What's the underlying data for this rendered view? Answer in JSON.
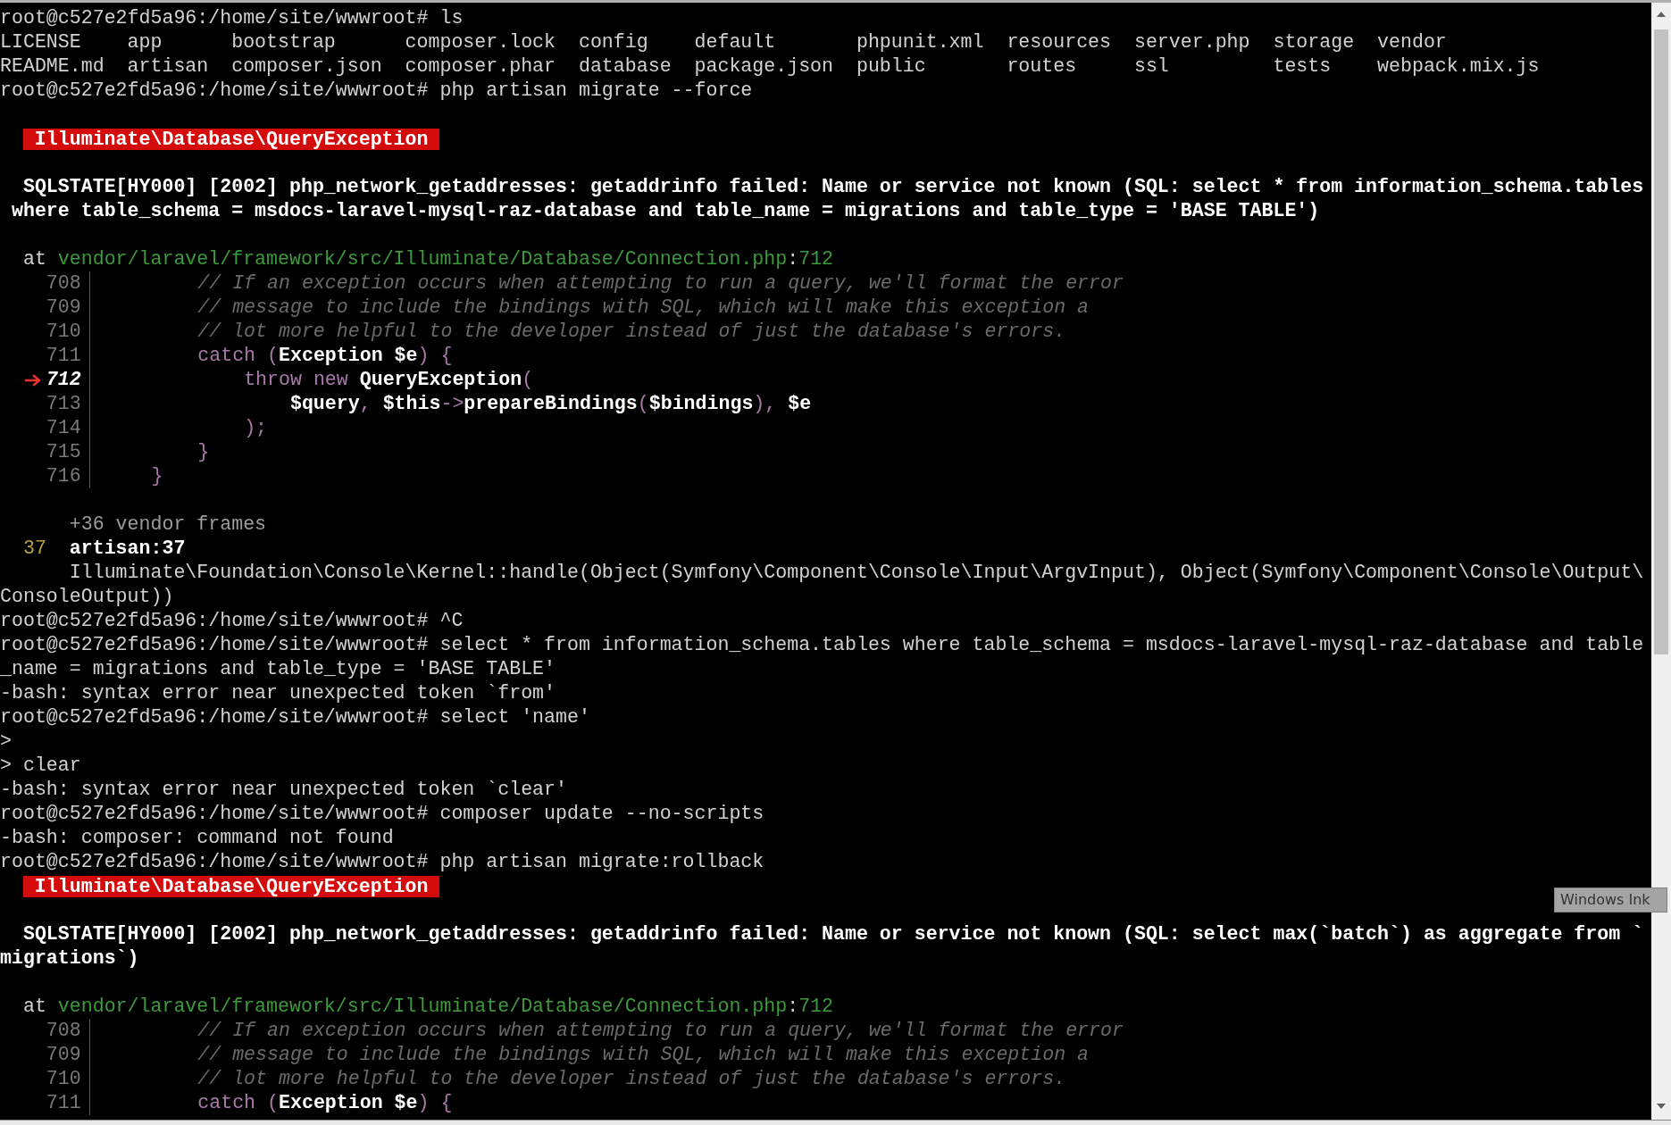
{
  "terminal": {
    "lines": [
      {
        "kind": "text",
        "segs": [
          {
            "kind": "plain",
            "text": "root@c527e2fd5a96:/home/site/wwwroot# ls"
          }
        ]
      },
      {
        "kind": "text",
        "segs": [
          {
            "kind": "plain",
            "text": "LICENSE    app      bootstrap      composer.lock  config    default       phpunit.xml  resources  server.php  storage  vendor"
          }
        ]
      },
      {
        "kind": "text",
        "segs": [
          {
            "kind": "plain",
            "text": "README.md  artisan  composer.json  composer.phar  database  package.json  public       routes     ssl         tests    webpack.mix.js"
          }
        ]
      },
      {
        "kind": "text",
        "segs": [
          {
            "kind": "plain",
            "text": "root@c527e2fd5a96:/home/site/wwwroot# php artisan migrate --force"
          }
        ]
      },
      {
        "kind": "blank"
      },
      {
        "kind": "badge",
        "text": "Illuminate\\Database\\QueryException"
      },
      {
        "kind": "blank"
      },
      {
        "kind": "text",
        "segs": [
          {
            "kind": "bold",
            "text": "  SQLSTATE[HY000] [2002] php_network_getaddresses: getaddrinfo failed: Name or service not known (SQL: select * from information_schema.tables"
          }
        ]
      },
      {
        "kind": "text",
        "segs": [
          {
            "kind": "bold",
            "text": " where table_schema = msdocs-laravel-mysql-raz-database and table_name = migrations and table_type = 'BASE TABLE')"
          }
        ]
      },
      {
        "kind": "blank"
      },
      {
        "kind": "text",
        "segs": [
          {
            "kind": "plain",
            "text": "  at "
          },
          {
            "kind": "path",
            "text": "vendor/laravel/framework/src/Illuminate/Database/Connection.php"
          },
          {
            "kind": "plain",
            "text": ":"
          },
          {
            "kind": "path",
            "text": "712"
          }
        ]
      },
      {
        "kind": "code",
        "number": "708",
        "current": false,
        "segs": [
          {
            "kind": "comment",
            "text": "        // If an exception occurs when attempting to run a query, we'll format the error"
          }
        ]
      },
      {
        "kind": "code",
        "number": "709",
        "current": false,
        "segs": [
          {
            "kind": "comment",
            "text": "        // message to include the bindings with SQL, which will make this exception a"
          }
        ]
      },
      {
        "kind": "code",
        "number": "710",
        "current": false,
        "segs": [
          {
            "kind": "comment",
            "text": "        // lot more helpful to the developer instead of just the database's errors."
          }
        ]
      },
      {
        "kind": "code",
        "number": "711",
        "current": false,
        "segs": [
          {
            "kind": "keyword",
            "text": "        catch"
          },
          {
            "kind": "keyword",
            "text": " ("
          },
          {
            "kind": "bold",
            "text": "Exception $e"
          },
          {
            "kind": "keyword",
            "text": ") {"
          }
        ]
      },
      {
        "kind": "code",
        "number": "712",
        "current": true,
        "segs": [
          {
            "kind": "keyword",
            "text": "            throw new "
          },
          {
            "kind": "bold",
            "text": "QueryException"
          },
          {
            "kind": "keyword",
            "text": "("
          }
        ]
      },
      {
        "kind": "code",
        "number": "713",
        "current": false,
        "segs": [
          {
            "kind": "bold",
            "text": "                $query"
          },
          {
            "kind": "keyword",
            "text": ", "
          },
          {
            "kind": "bold",
            "text": "$this"
          },
          {
            "kind": "keyword",
            "text": "->"
          },
          {
            "kind": "bold",
            "text": "prepareBindings"
          },
          {
            "kind": "keyword",
            "text": "("
          },
          {
            "kind": "bold",
            "text": "$bindings"
          },
          {
            "kind": "keyword",
            "text": "), "
          },
          {
            "kind": "bold",
            "text": "$e"
          }
        ]
      },
      {
        "kind": "code",
        "number": "714",
        "current": false,
        "segs": [
          {
            "kind": "keyword",
            "text": "            );"
          }
        ]
      },
      {
        "kind": "code",
        "number": "715",
        "current": false,
        "segs": [
          {
            "kind": "keyword",
            "text": "        }"
          }
        ]
      },
      {
        "kind": "code",
        "number": "716",
        "current": false,
        "segs": [
          {
            "kind": "keyword",
            "text": "    }"
          }
        ]
      },
      {
        "kind": "blank"
      },
      {
        "kind": "text",
        "segs": [
          {
            "kind": "dim",
            "text": "      +36 vendor frames"
          }
        ]
      },
      {
        "kind": "text",
        "segs": [
          {
            "kind": "yellow",
            "text": "  37"
          },
          {
            "kind": "bold",
            "text": "  artisan:37"
          }
        ]
      },
      {
        "kind": "text",
        "segs": [
          {
            "kind": "plain",
            "text": "      Illuminate\\Foundation\\Console\\Kernel::handle(Object(Symfony\\Component\\Console\\Input\\ArgvInput), Object(Symfony\\Component\\Console\\Output\\"
          }
        ]
      },
      {
        "kind": "text",
        "segs": [
          {
            "kind": "plain",
            "text": "ConsoleOutput))"
          }
        ]
      },
      {
        "kind": "text",
        "segs": [
          {
            "kind": "plain",
            "text": "root@c527e2fd5a96:/home/site/wwwroot# ^C"
          }
        ]
      },
      {
        "kind": "text",
        "segs": [
          {
            "kind": "plain",
            "text": "root@c527e2fd5a96:/home/site/wwwroot# select * from information_schema.tables where table_schema = msdocs-laravel-mysql-raz-database and table"
          }
        ]
      },
      {
        "kind": "text",
        "segs": [
          {
            "kind": "plain",
            "text": "_name = migrations and table_type = 'BASE TABLE'"
          }
        ]
      },
      {
        "kind": "text",
        "segs": [
          {
            "kind": "plain",
            "text": "-bash: syntax error near unexpected token `from'"
          }
        ]
      },
      {
        "kind": "text",
        "segs": [
          {
            "kind": "plain",
            "text": "root@c527e2fd5a96:/home/site/wwwroot# select 'name'"
          }
        ]
      },
      {
        "kind": "text",
        "segs": [
          {
            "kind": "plain",
            "text": ">"
          }
        ]
      },
      {
        "kind": "text",
        "segs": [
          {
            "kind": "plain",
            "text": "> clear"
          }
        ]
      },
      {
        "kind": "text",
        "segs": [
          {
            "kind": "plain",
            "text": "-bash: syntax error near unexpected token `clear'"
          }
        ]
      },
      {
        "kind": "text",
        "segs": [
          {
            "kind": "plain",
            "text": "root@c527e2fd5a96:/home/site/wwwroot# composer update --no-scripts"
          }
        ]
      },
      {
        "kind": "text",
        "segs": [
          {
            "kind": "plain",
            "text": "-bash: composer: command not found"
          }
        ]
      },
      {
        "kind": "text",
        "segs": [
          {
            "kind": "plain",
            "text": "root@c527e2fd5a96:/home/site/wwwroot# php artisan migrate:rollback"
          }
        ]
      },
      {
        "kind": "badge",
        "text": "Illuminate\\Database\\QueryException"
      },
      {
        "kind": "blank"
      },
      {
        "kind": "text",
        "segs": [
          {
            "kind": "bold",
            "text": "  SQLSTATE[HY000] [2002] php_network_getaddresses: getaddrinfo failed: Name or service not known (SQL: select max(`batch`) as aggregate from `"
          }
        ]
      },
      {
        "kind": "text",
        "segs": [
          {
            "kind": "bold",
            "text": "migrations`)"
          }
        ]
      },
      {
        "kind": "blank"
      },
      {
        "kind": "text",
        "segs": [
          {
            "kind": "plain",
            "text": "  at "
          },
          {
            "kind": "path",
            "text": "vendor/laravel/framework/src/Illuminate/Database/Connection.php"
          },
          {
            "kind": "plain",
            "text": ":"
          },
          {
            "kind": "path",
            "text": "712"
          }
        ]
      },
      {
        "kind": "code",
        "number": "708",
        "current": false,
        "segs": [
          {
            "kind": "comment",
            "text": "        // If an exception occurs when attempting to run a query, we'll format the error"
          }
        ]
      },
      {
        "kind": "code",
        "number": "709",
        "current": false,
        "segs": [
          {
            "kind": "comment",
            "text": "        // message to include the bindings with SQL, which will make this exception a"
          }
        ]
      },
      {
        "kind": "code",
        "number": "710",
        "current": false,
        "segs": [
          {
            "kind": "comment",
            "text": "        // lot more helpful to the developer instead of just the database's errors."
          }
        ]
      },
      {
        "kind": "code",
        "number": "711",
        "current": false,
        "segs": [
          {
            "kind": "keyword",
            "text": "        catch"
          },
          {
            "kind": "keyword",
            "text": " ("
          },
          {
            "kind": "bold",
            "text": "Exception $e"
          },
          {
            "kind": "keyword",
            "text": ") {"
          }
        ]
      }
    ]
  },
  "tooltip": {
    "text": "Windows Ink"
  }
}
